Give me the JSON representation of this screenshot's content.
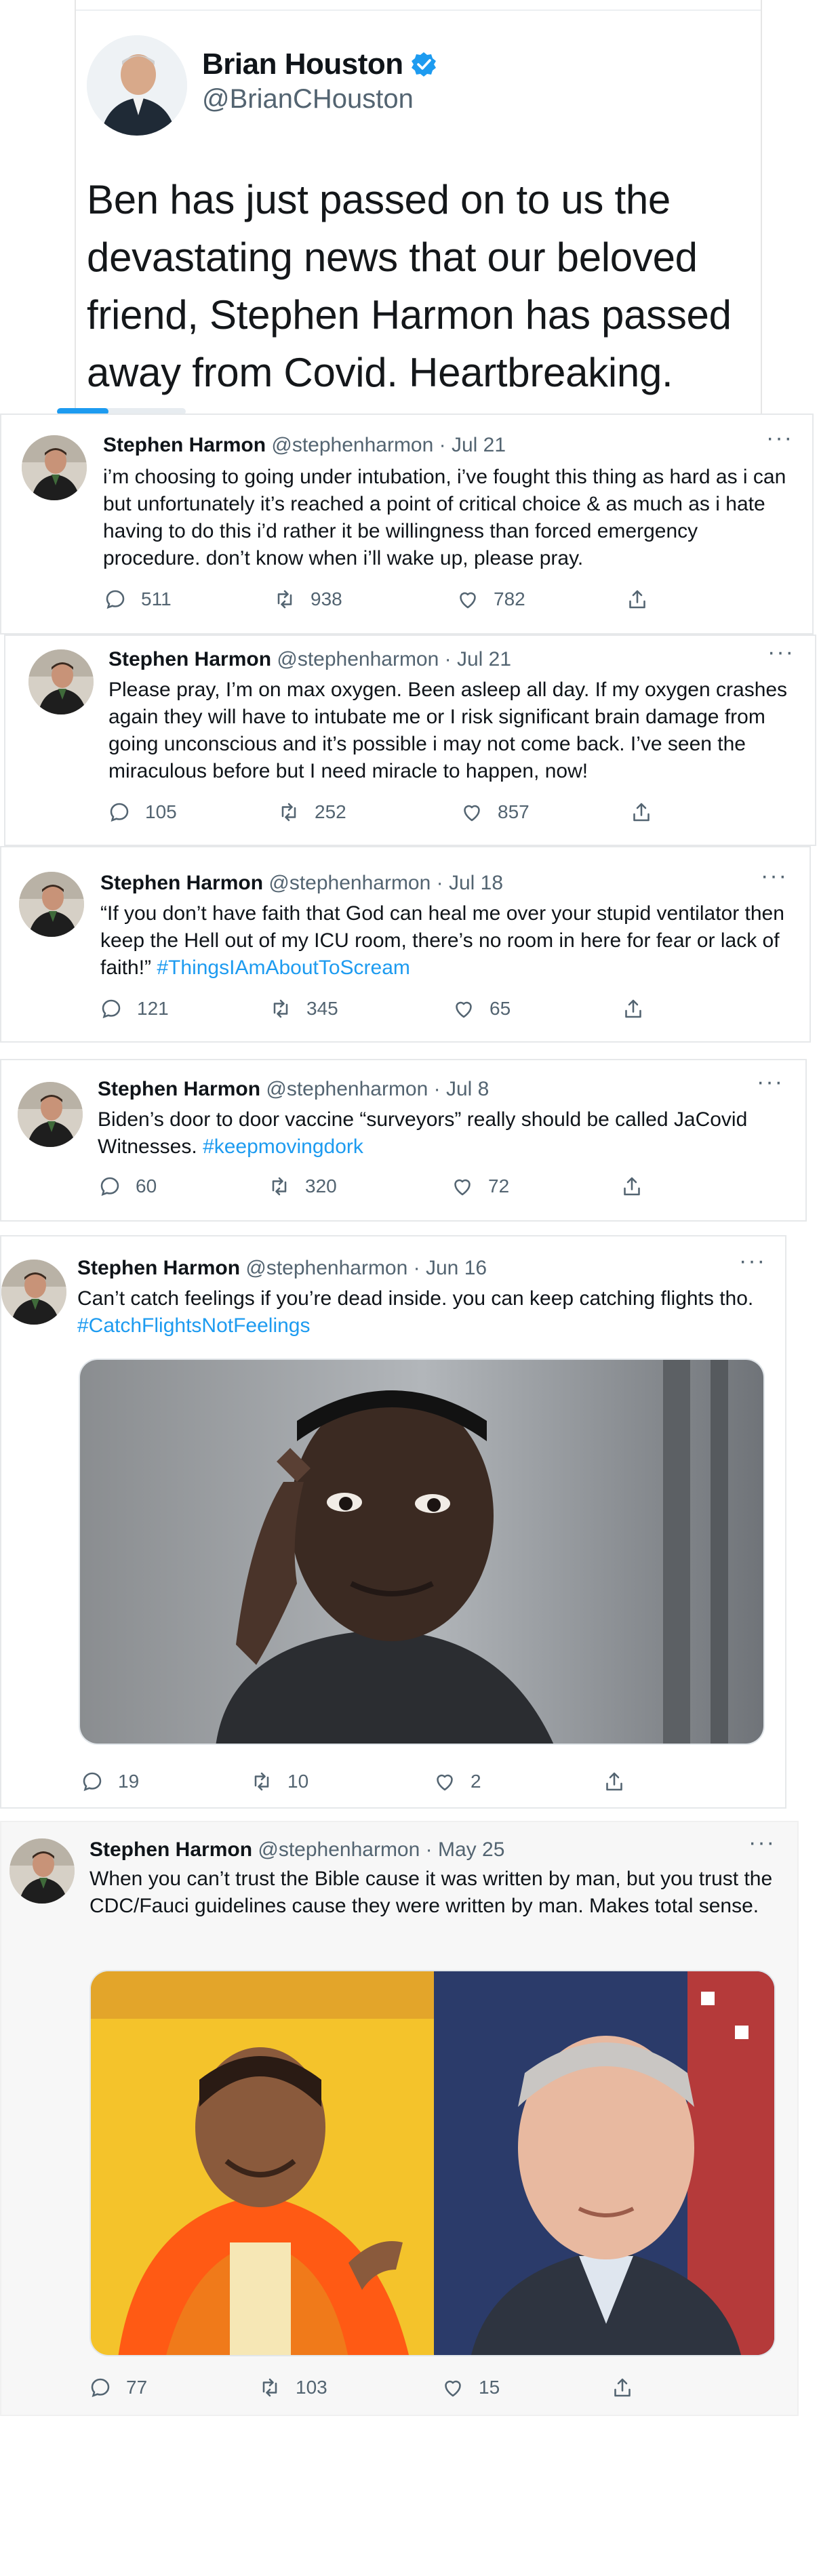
{
  "top_tweet": {
    "name": "Brian Houston",
    "handle": "@BrianCHouston",
    "text": "Ben has just passed on to us the devastating news that our beloved friend, Stephen Harmon has passed away from Covid. Heartbreaking.",
    "media_progress_fraction": 0.4
  },
  "tweets": [
    {
      "name": "Stephen Harmon",
      "handle": "@stephenharmon",
      "sep": "·",
      "date": "Jul 21",
      "text": "i’m choosing to going under intubation, i’ve fought this thing as hard as i can but unfortunately it’s reached a point of critical choice & as much as i hate having to do this i’d rather it be willingness than forced emergency procedure. don’t know when i’ll wake up, please pray.",
      "replies": "511",
      "retweets": "938",
      "likes": "782"
    },
    {
      "name": "Stephen Harmon",
      "handle": "@stephenharmon",
      "sep": "·",
      "date": "Jul 21",
      "text": "Please pray, I’m on max oxygen. Been asleep all day. If my oxygen crashes again they will have to intubate me or I risk significant brain damage from going unconscious and it’s possible i may not come back. I’ve seen the miraculous before but I need miracle to happen, now!",
      "replies": "105",
      "retweets": "252",
      "likes": "857"
    },
    {
      "name": "Stephen Harmon",
      "handle": "@stephenharmon",
      "sep": "·",
      "date": "Jul 18",
      "text": "“If you don’t have faith that God can heal me over your stupid ventilator then keep the Hell out of my ICU room, there’s no room in here for fear or lack of faith!”",
      "hashtag": "#ThingsIAmAboutToScream",
      "replies": "121",
      "retweets": "345",
      "likes": "65"
    },
    {
      "name": "Stephen Harmon",
      "handle": "@stephenharmon",
      "sep": "·",
      "date": "Jul 8",
      "text": "Biden’s door to door vaccine “surveyors” really should be called JaCovid Witnesses.",
      "hashtag": "#keepmovingdork",
      "replies": "60",
      "retweets": "320",
      "likes": "72"
    },
    {
      "name": "Stephen Harmon",
      "handle": "@stephenharmon",
      "sep": "·",
      "date": "Jun 16",
      "text": "Can’t catch feelings if you’re dead inside. you can keep catching flights tho.",
      "hashtag": "#CatchFlightsNotFeelings",
      "replies": "19",
      "retweets": "10",
      "likes": "2"
    },
    {
      "name": "Stephen Harmon",
      "handle": "@stephenharmon",
      "sep": "·",
      "date": "May 25",
      "text": "When you can’t trust the Bible cause it was written by man, but you trust the CDC/Fauci guidelines cause they were written by man. Makes total sense.",
      "replies": "77",
      "retweets": "103",
      "likes": "15"
    }
  ],
  "icons": {
    "reply": "reply-icon",
    "retweet": "retweet-icon",
    "like": "heart-icon",
    "share": "share-icon",
    "more": "more-icon",
    "verified": "verified-badge-icon"
  },
  "colors": {
    "accent": "#1d9bf0",
    "secondary_text": "#536471"
  }
}
